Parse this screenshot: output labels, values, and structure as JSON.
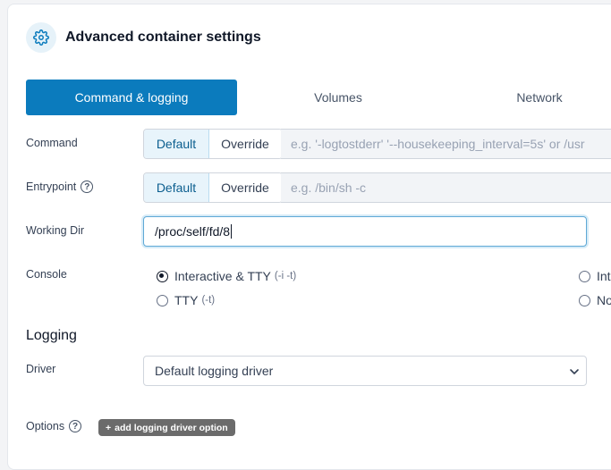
{
  "header": {
    "title": "Advanced container settings",
    "icon": "gear-icon"
  },
  "tabs": [
    {
      "label": "Command & logging",
      "active": true
    },
    {
      "label": "Volumes",
      "active": false
    },
    {
      "label": "Network",
      "active": false
    }
  ],
  "command": {
    "label": "Command",
    "default_label": "Default",
    "override_label": "Override",
    "placeholder": "e.g. '-logtostderr' '--housekeeping_interval=5s' or /usr"
  },
  "entrypoint": {
    "label": "Entrypoint",
    "default_label": "Default",
    "override_label": "Override",
    "placeholder": "e.g. /bin/sh -c"
  },
  "working_dir": {
    "label": "Working Dir",
    "value": "/proc/self/fd/8"
  },
  "console": {
    "label": "Console",
    "options": [
      {
        "label": "Interactive & TTY",
        "hint": "(-i -t)",
        "checked": true
      },
      {
        "label": "TTY",
        "hint": "(-t)",
        "checked": false
      },
      {
        "label": "Int",
        "hint": "",
        "checked": false
      },
      {
        "label": "No",
        "hint": "",
        "checked": false
      }
    ]
  },
  "logging": {
    "section_title": "Logging",
    "driver_label": "Driver",
    "driver_value": "Default logging driver",
    "options_label": "Options",
    "add_option_label": "add logging driver option"
  },
  "colors": {
    "accent": "#0b7bbd"
  }
}
